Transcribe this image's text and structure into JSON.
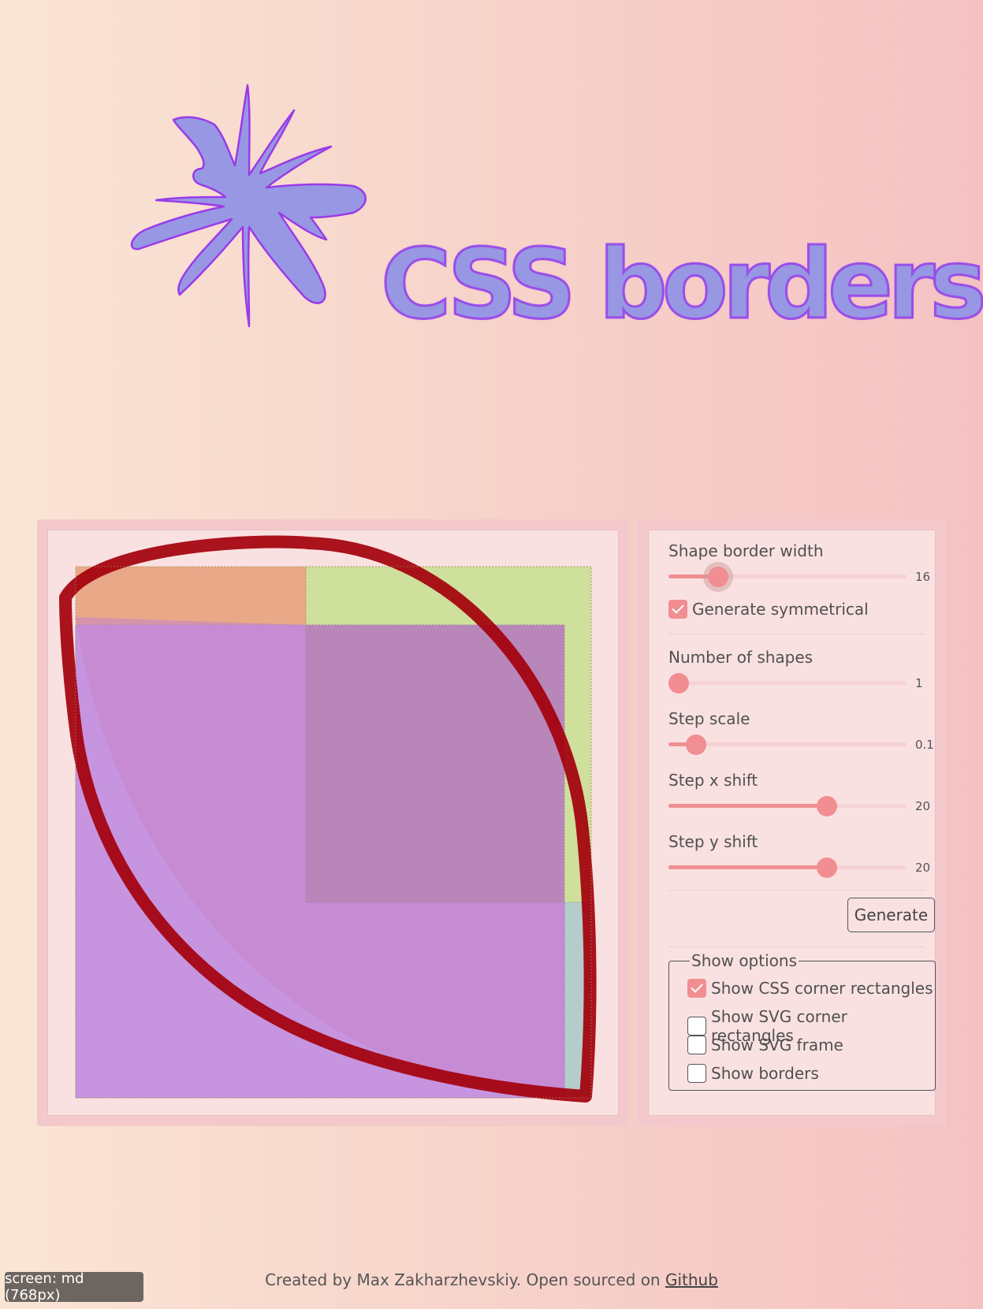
{
  "header": {
    "title": "CSS borders"
  },
  "colors": {
    "accent": "#f08e92",
    "shape_stroke": "#a3000b",
    "title_fill": "#9797e4",
    "title_stroke": "#9a4ee8"
  },
  "controls": {
    "border_width": {
      "label": "Shape border width",
      "value": "16",
      "fraction": 0.18
    },
    "symmetrical": {
      "label": "Generate symmetrical",
      "checked": true
    },
    "num_shapes": {
      "label": "Number of shapes",
      "value": "1",
      "fraction": 0.0
    },
    "step_scale": {
      "label": "Step scale",
      "value": "0.1",
      "fraction": 0.08
    },
    "step_x": {
      "label": "Step x shift",
      "value": "20",
      "fraction": 0.68
    },
    "step_y": {
      "label": "Step y shift",
      "value": "20",
      "fraction": 0.68
    },
    "generate_label": "Generate"
  },
  "show_options": {
    "legend": "Show options",
    "items": [
      {
        "label": "Show CSS corner rectangles",
        "checked": true
      },
      {
        "label": "Show SVG corner rectangles",
        "checked": false
      },
      {
        "label": "Show SVG frame",
        "checked": false
      },
      {
        "label": "Show borders",
        "checked": false
      }
    ]
  },
  "footer": {
    "text": "Created by Max Zakharzhevskiy. Open sourced on ",
    "link": "Github"
  },
  "screen_badge": "screen: md (768px)"
}
